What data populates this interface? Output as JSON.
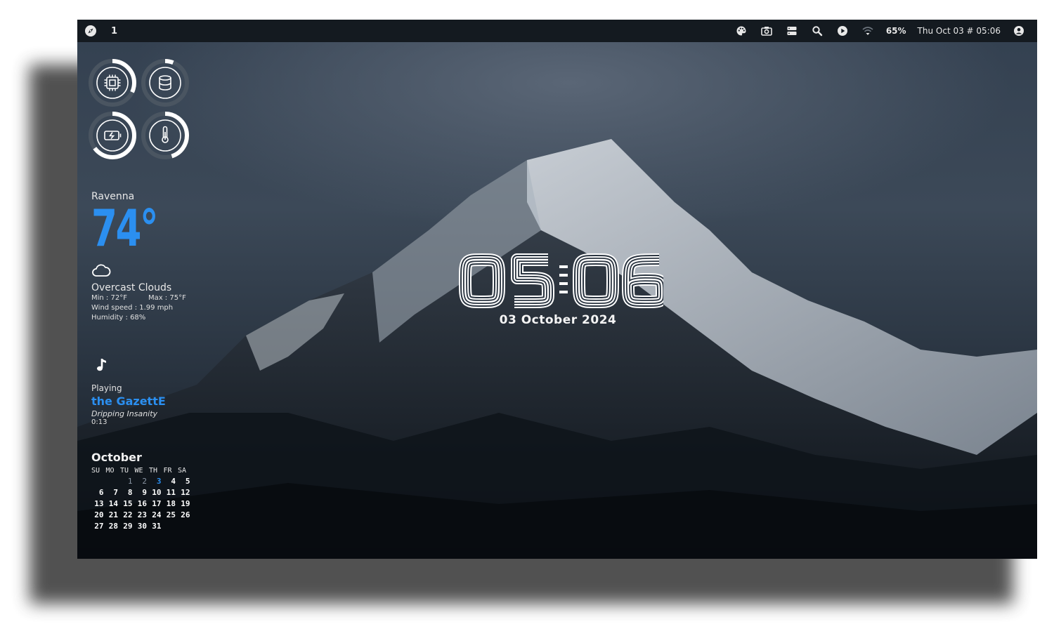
{
  "topbar": {
    "workspace": "1",
    "battery": "65%",
    "datetime": "Thu Oct 03 # 05:06"
  },
  "system": {
    "cpu": 0.32,
    "memory": 0.06,
    "battery": 0.65,
    "temperature": 0.45
  },
  "weather": {
    "city": "Ravenna",
    "temperature": "74°",
    "condition": "Overcast Clouds",
    "min": "Min : 72°F",
    "max": "Max : 75°F",
    "wind": "Wind speed : 1.99 mph",
    "humidity": "Humidity : 68%"
  },
  "music": {
    "status": "Playing",
    "artist": "the GazettE",
    "title": "Dripping Insanity",
    "elapsed": "0:13"
  },
  "calendar": {
    "month": "October",
    "weekdays": [
      "SU",
      "MO",
      "TU",
      "WE",
      "TH",
      "FR",
      "SA"
    ],
    "first_weekday": 2,
    "days_in_month": 31,
    "today": 3
  },
  "clock": {
    "time": "05:06",
    "date": "03 October 2024"
  },
  "colors": {
    "accent": "#2b8ff0",
    "bar": "#141a20"
  }
}
